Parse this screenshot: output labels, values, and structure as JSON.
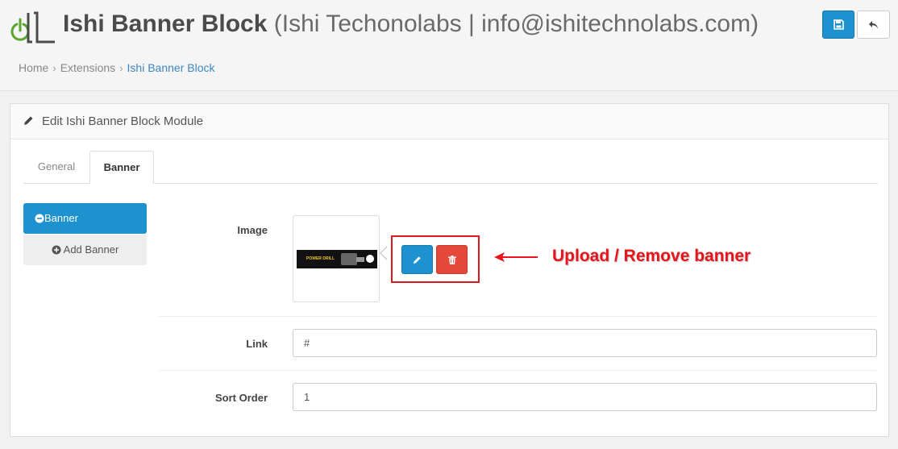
{
  "header": {
    "title_main": "Ishi Banner Block",
    "title_sub": "(Ishi Techonolabs | info@ishitechnolabs.com)",
    "save_icon": "save-icon",
    "back_icon": "reply-icon"
  },
  "breadcrumb": [
    {
      "label": "Home"
    },
    {
      "label": "Extensions"
    },
    {
      "label": "Ishi Banner Block"
    }
  ],
  "panel": {
    "title": "Edit Ishi Banner Block Module",
    "tabs": [
      {
        "label": "General",
        "active": false
      },
      {
        "label": "Banner",
        "active": true
      }
    ],
    "sidebar": {
      "active_item": "Banner",
      "add_label": "Add Banner"
    },
    "form": {
      "image_label": "Image",
      "thumb_text": "POWER DRILL",
      "link_label": "Link",
      "link_value": "#",
      "sort_label": "Sort Order",
      "sort_value": "1"
    },
    "annotation": "Upload / Remove banner"
  },
  "colors": {
    "primary": "#1e91cf",
    "danger": "#e4483a",
    "annotation": "#e8141c"
  }
}
